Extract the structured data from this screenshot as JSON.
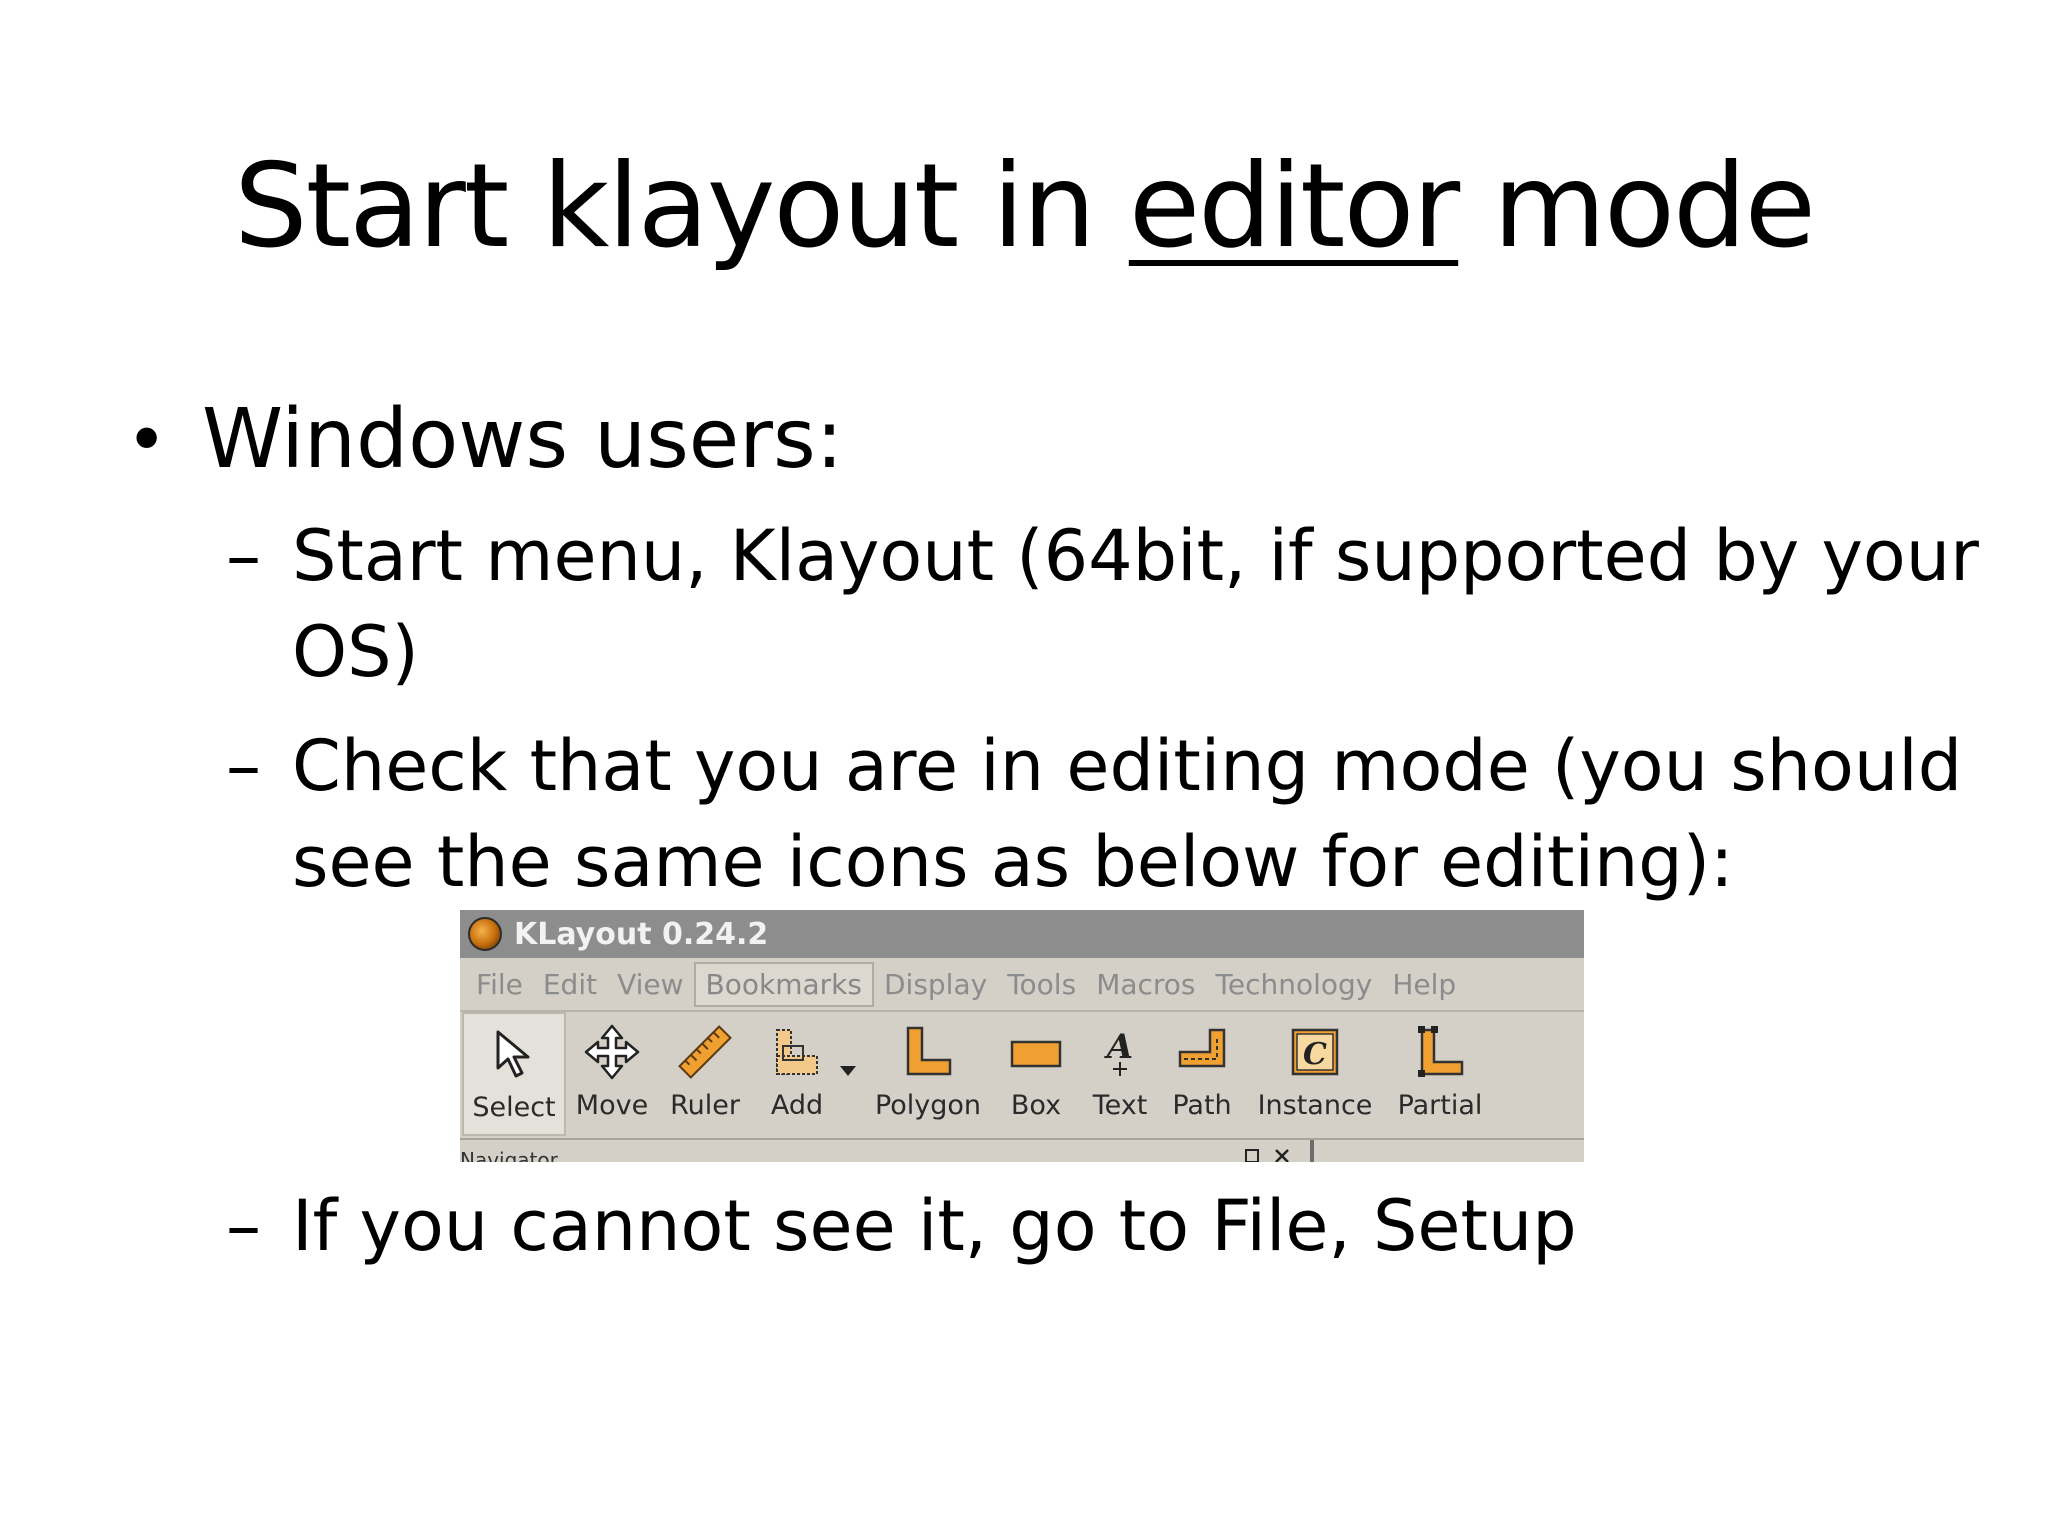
{
  "slide": {
    "title_prefix": "Start klayout in ",
    "title_emphasis": "editor",
    "title_suffix": " mode",
    "bullet": {
      "symbol": "•",
      "text": "Windows users:"
    },
    "sub_dash": "–",
    "sub_items": [
      {
        "lines": [
          "Start menu, Klayout (64bit, if supported by your",
          "OS)"
        ]
      },
      {
        "lines": [
          "Check that you are in editing mode (you should",
          "see the same icons as below for editing):"
        ]
      },
      {
        "lines": [
          "If you cannot see it, go to File, Setup"
        ]
      }
    ]
  },
  "klayout": {
    "window_title": "KLayout 0.24.2",
    "app_icon": "klayout-logo-icon",
    "menu": [
      "File",
      "Edit",
      "View",
      "Bookmarks",
      "Display",
      "Tools",
      "Macros",
      "Technology",
      "Help"
    ],
    "active_menu": "Bookmarks",
    "tools": [
      {
        "label": "Select",
        "icon": "select-arrow-icon",
        "selected": true
      },
      {
        "label": "Move",
        "icon": "move-icon"
      },
      {
        "label": "Ruler",
        "icon": "ruler-icon"
      },
      {
        "label": "Add",
        "icon": "add-icon",
        "dropdown": true
      },
      {
        "label": "Polygon",
        "icon": "polygon-icon"
      },
      {
        "label": "Box",
        "icon": "box-icon"
      },
      {
        "label": "Text",
        "icon": "text-icon"
      },
      {
        "label": "Path",
        "icon": "path-icon"
      },
      {
        "label": "Instance",
        "icon": "instance-icon"
      },
      {
        "label": "Partial",
        "icon": "partial-icon"
      }
    ],
    "panel_label": "Navigator",
    "accent_color": "#f0a030"
  }
}
